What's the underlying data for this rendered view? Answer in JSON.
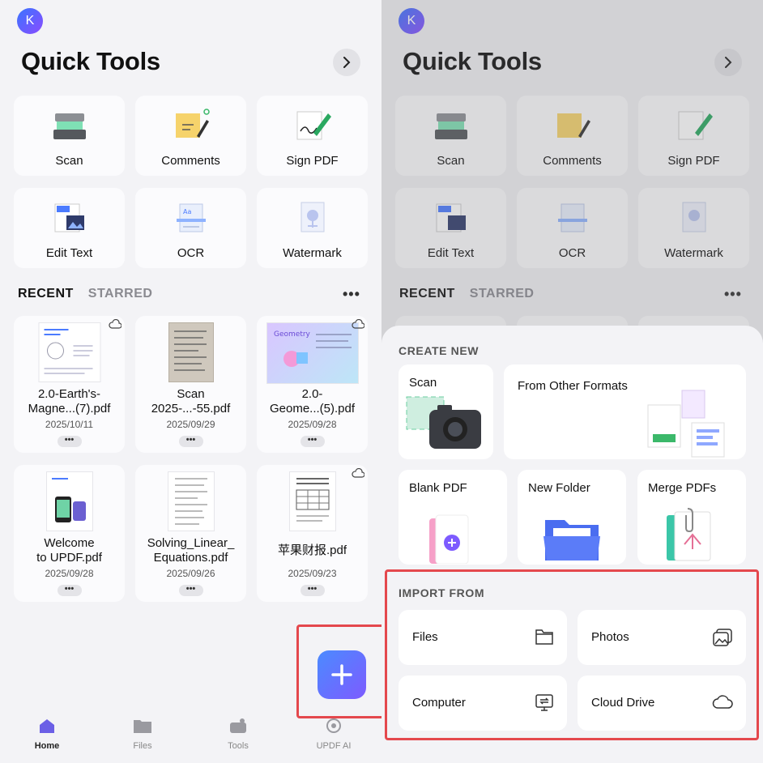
{
  "left": {
    "avatar_letter": "K",
    "title": "Quick Tools",
    "tools": [
      {
        "label": "Scan",
        "icon": "scanner-icon"
      },
      {
        "label": "Comments",
        "icon": "sticky-note-icon"
      },
      {
        "label": "Sign PDF",
        "icon": "signature-icon"
      },
      {
        "label": "Edit Text",
        "icon": "edit-text-icon"
      },
      {
        "label": "OCR",
        "icon": "ocr-icon"
      },
      {
        "label": "Watermark",
        "icon": "watermark-icon"
      }
    ],
    "tabs": {
      "recent": "RECENT",
      "starred": "STARRED"
    },
    "more": "•••",
    "files": [
      {
        "name_line1": "2.0-Earth's-",
        "name_line2": "Magne...(7).pdf",
        "date": "2025/10/11",
        "cloud": true
      },
      {
        "name_line1": "Scan",
        "name_line2": "2025-...-55.pdf",
        "date": "2025/09/29",
        "cloud": false
      },
      {
        "name_line1": "2.0-",
        "name_line2": "Geome...(5).pdf",
        "date": "2025/09/28",
        "cloud": true
      },
      {
        "name_line1": "Welcome",
        "name_line2": "to UPDF.pdf",
        "date": "2025/09/28",
        "cloud": false
      },
      {
        "name_line1": "Solving_Linear_",
        "name_line2": "Equations.pdf",
        "date": "2025/09/26",
        "cloud": false
      },
      {
        "name_line1": "苹果财报.pdf",
        "name_line2": "",
        "date": "2025/09/23",
        "cloud": true
      }
    ],
    "nav": [
      {
        "label": "Home",
        "icon": "home-icon",
        "active": true
      },
      {
        "label": "Files",
        "icon": "folder-icon",
        "active": false
      },
      {
        "label": "Tools",
        "icon": "tools-icon",
        "active": false
      },
      {
        "label": "UPDF AI",
        "icon": "ai-icon",
        "active": false
      }
    ],
    "fab_icon": "plus-icon"
  },
  "right": {
    "avatar_letter": "K",
    "title": "Quick Tools",
    "tools": [
      {
        "label": "Scan"
      },
      {
        "label": "Comments"
      },
      {
        "label": "Sign PDF"
      },
      {
        "label": "Edit Text"
      },
      {
        "label": "OCR"
      },
      {
        "label": "Watermark"
      }
    ],
    "tabs": {
      "recent": "RECENT",
      "starred": "STARRED"
    },
    "more": "•••",
    "sheet": {
      "create_new_title": "CREATE NEW",
      "create": [
        {
          "label": "Scan",
          "icon": "camera-icon"
        },
        {
          "label": "From Other Formats",
          "icon": "formats-icon"
        },
        {
          "label": "Blank PDF",
          "icon": "blank-pdf-icon"
        },
        {
          "label": "New Folder",
          "icon": "new-folder-icon"
        },
        {
          "label": "Merge PDFs",
          "icon": "merge-icon"
        }
      ],
      "import_title": "IMPORT FROM",
      "import": [
        {
          "label": "Files",
          "icon": "folder-outline-icon"
        },
        {
          "label": "Photos",
          "icon": "photos-icon"
        },
        {
          "label": "Computer",
          "icon": "computer-icon"
        },
        {
          "label": "Cloud Drive",
          "icon": "cloud-icon"
        }
      ]
    }
  },
  "colors": {
    "accent": "#4b7bff",
    "highlight": "#e4484d"
  }
}
